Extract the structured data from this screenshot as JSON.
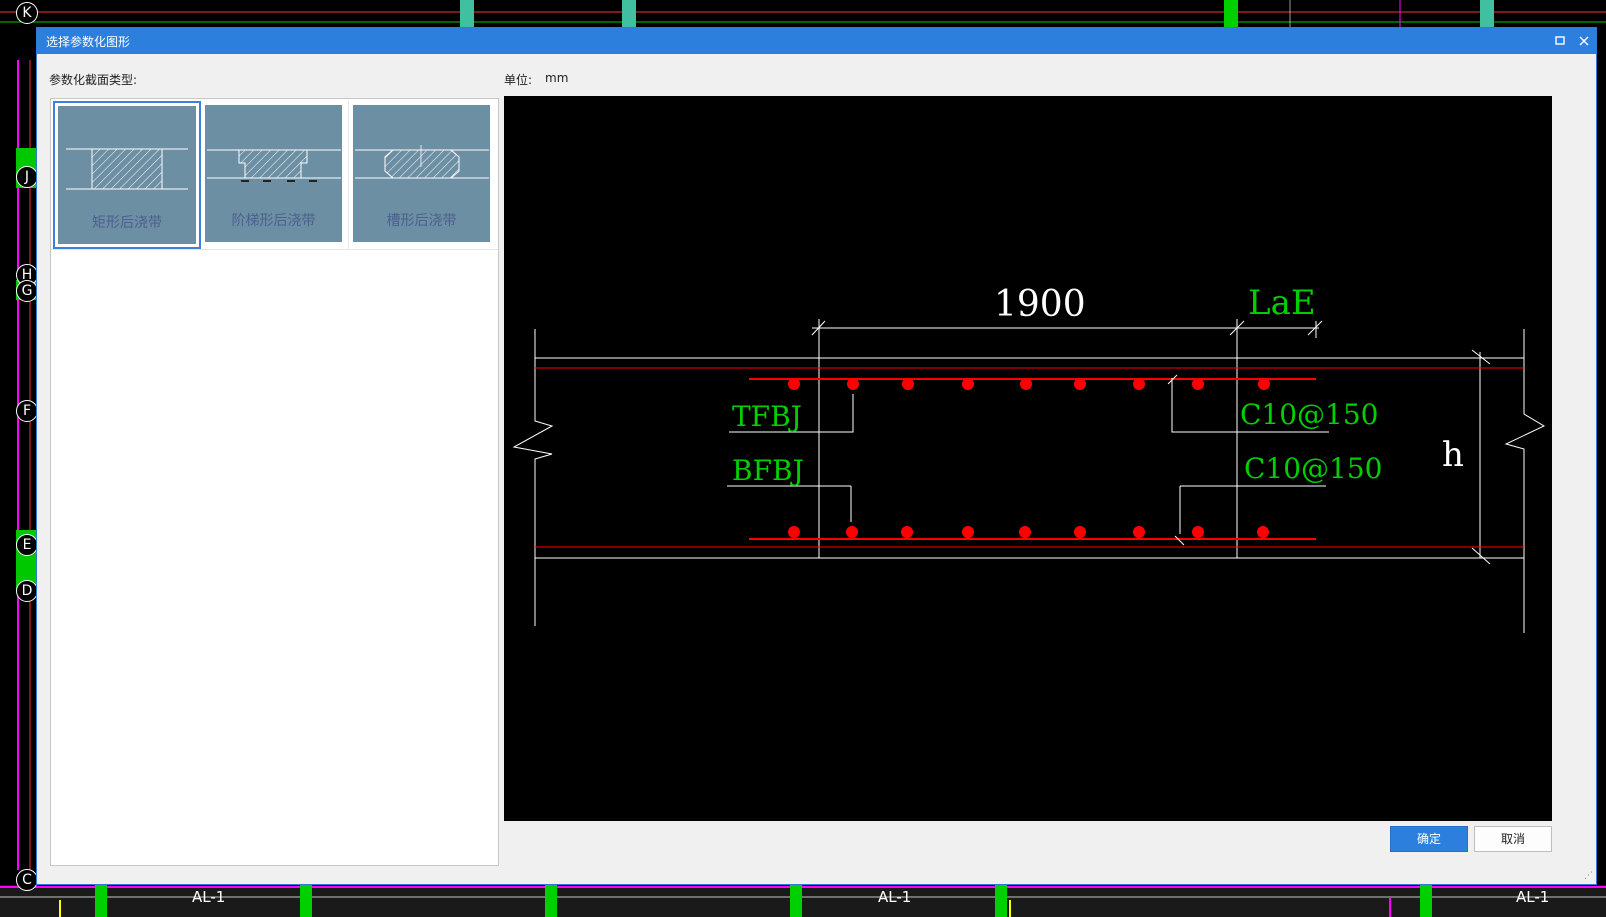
{
  "dialog": {
    "title": "选择参数化图形",
    "section_type_label": "参数化截面类型:",
    "unit_label": "单位:",
    "unit_value": "mm",
    "ok_label": "确定",
    "cancel_label": "取消",
    "maximize_icon": "maximize-icon",
    "close_icon": "close-icon"
  },
  "section_types": [
    {
      "label": "矩形后浇带",
      "selected": true
    },
    {
      "label": "阶梯形后浇带",
      "selected": false
    },
    {
      "label": "槽形后浇带",
      "selected": false
    }
  ],
  "drawing": {
    "dim_main": "1900",
    "dim_lae": "LaE",
    "label_top_left": "TFBJ",
    "label_bottom_left": "BFBJ",
    "label_top_right": "C10@150",
    "label_bottom_right": "C10@150",
    "label_height": "h"
  },
  "background": {
    "axis_labels": [
      "K",
      "J",
      "H",
      "G",
      "F",
      "E",
      "D",
      "C"
    ],
    "beam_labels": [
      "AL-1",
      "AL-1",
      "AL-1"
    ]
  },
  "colors": {
    "title_bar": "#2d7fde",
    "thumb_bg": "#6d8fa3",
    "selected_border": "#3c82d8",
    "rebar_red": "#ff0000",
    "cad_green": "#00c800",
    "cad_white": "#ffffff"
  }
}
